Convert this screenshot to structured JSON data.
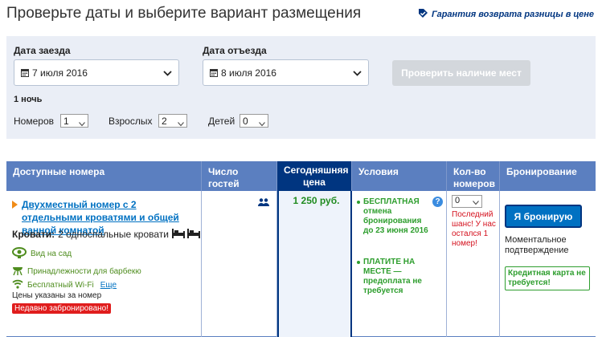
{
  "header": {
    "title": "Проверьте даты и выберите вариант размещения",
    "guarantee": "Гарантия возврата разницы в цене"
  },
  "search": {
    "checkin_label": "Дата заезда",
    "checkin_value": "7 июля 2016",
    "checkout_label": "Дата отъезда",
    "checkout_value": "8 июля 2016",
    "check_button": "Проверить наличие мест",
    "nights": "1 ночь",
    "rooms_label": "Номеров",
    "rooms_value": "1",
    "adults_label": "Взрослых",
    "adults_value": "2",
    "children_label": "Детей",
    "children_value": "0"
  },
  "table": {
    "headers": {
      "rooms": "Доступные номера",
      "guests": "Число гостей",
      "price": "Сегодняшняя цена",
      "conditions": "Условия",
      "quantity": "Кол-во номеров",
      "booking": "Бронирование"
    },
    "row": {
      "room_name": "Двухместный номер с 2 отдельными кроватями и общей ванной комнатой",
      "beds_label": "Кровати:",
      "beds_value": "2 односпальные кровати",
      "facilities": [
        {
          "icon": "garden-icon",
          "label": "Вид на сад"
        },
        {
          "icon": "barbecue-icon",
          "label": "Принадлежности для барбекю"
        },
        {
          "icon": "wifi-icon",
          "label": "Бесплатный Wi-Fi"
        }
      ],
      "more_link": "Еще",
      "prices_note": "Цены указаны за номер",
      "recent_badge": "Недавно забронировано!",
      "guests_icon": "two-guests-icon",
      "price": "1 250 руб.",
      "conditions": [
        "БЕСПЛАТНАЯ отмена бронирования до 23 июня 2016",
        "ПЛАТИТЕ НА МЕСТЕ — предоплата не требуется"
      ],
      "quantity_value": "0",
      "last_chance": "Последний шанс! У нас остался 1 номер!",
      "book_button": "Я бронирую",
      "confirmation": "Моментальное подтверждение",
      "no_card": "Кредитная карта не требуется!"
    }
  },
  "colors": {
    "header_blue": "#5b7fc0",
    "dark_blue": "#003580",
    "link_blue": "#0071c2",
    "green": "#2e9e2e",
    "red": "#e01d1d"
  }
}
